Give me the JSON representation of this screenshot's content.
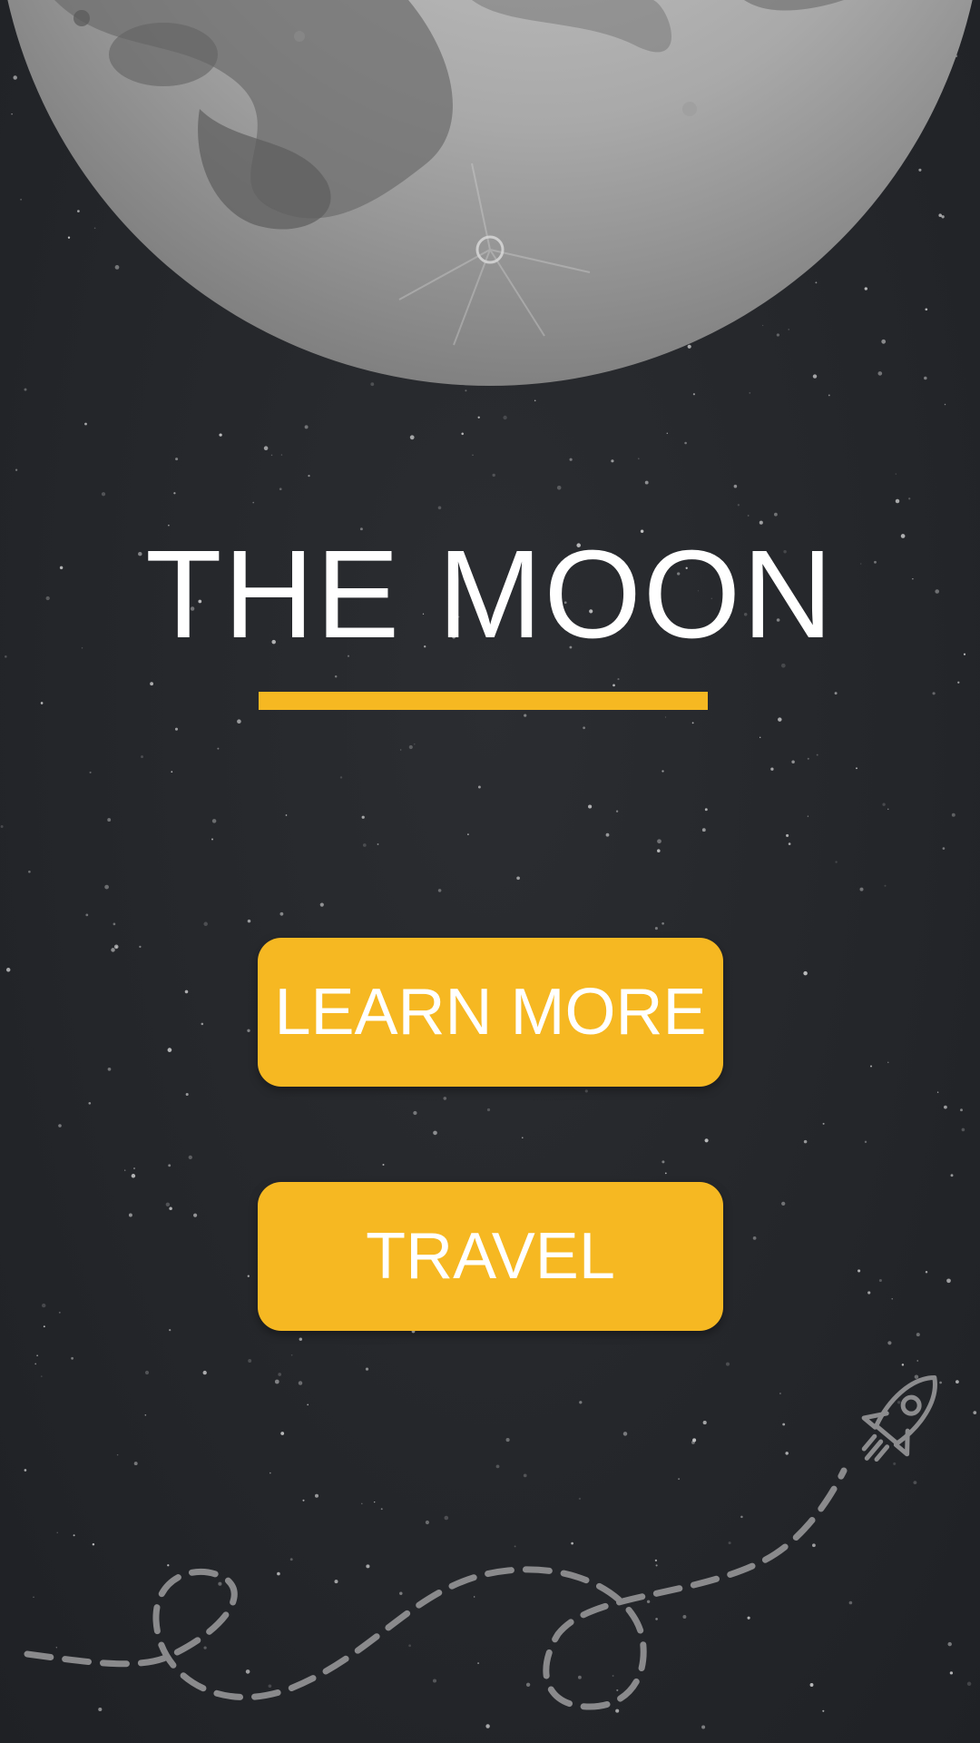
{
  "hero": {
    "title": "THE MOON"
  },
  "actions": {
    "learn_more_label": "LEARN MORE",
    "travel_label": "TRAVEL"
  },
  "theme": {
    "background": "#26282c",
    "accent": "#f6b822",
    "text": "#ffffff"
  },
  "icons": {
    "moon": "moon-image",
    "rocket": "rocket-icon",
    "trail": "dashed-trail"
  }
}
